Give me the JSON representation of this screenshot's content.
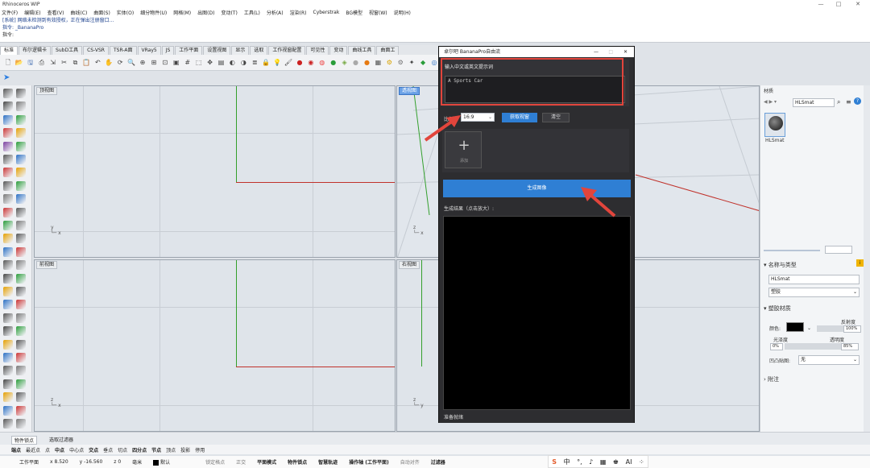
{
  "window": {
    "title": "Rhinoceros WIP"
  },
  "menu": [
    "文件(F)",
    "编辑(E)",
    "查看(V)",
    "曲线(C)",
    "曲面(S)",
    "实体(O)",
    "细分物件(U)",
    "网格(M)",
    "出图(D)",
    "变动(T)",
    "工具(L)",
    "分析(A)",
    "渲染(R)",
    "Cyberstrak",
    "BG模型",
    "视窗(W)",
    "说明(H)"
  ],
  "command_history": {
    "line1": "[系统] 网络未检测到有效授权，正在弹出注册窗口...",
    "line2": "指令: _BananaPro",
    "prompt": "指令:"
  },
  "tabs": [
    "标准",
    "布尔逻辑卡",
    "SubD工具",
    "CS-VSR",
    "TSR-A面",
    "VRay5",
    "JS",
    "工作平面",
    "设置视图",
    "显示",
    "选取",
    "工作视窗配置",
    "可见性",
    "变动",
    "曲线工具",
    "曲面工"
  ],
  "viewports": {
    "top": "顶视图",
    "perspective": "透视图",
    "front": "前视图",
    "right": "右视图",
    "axis_x": "x",
    "axis_y": "y",
    "axis_z": "z"
  },
  "plugin": {
    "title": "卓尔吧 BananaPro自由流",
    "prompt_label": "输入中文或英文提示词",
    "prompt_value": "A Sports Car",
    "ratio_label": "比例:",
    "ratio_value": "16:9",
    "get_view_button": "获取视窗",
    "clear_button": "清空",
    "add_label": "添加",
    "generate_button": "生成图像",
    "result_label": "生成结果（点击放大）:",
    "status": "准备就绪"
  },
  "right_panel": {
    "materials_title": "材质",
    "search_value": "HLSmat",
    "material_item": "HLSmat",
    "name_type_header": "名称与类型",
    "name_value": "HLSmat",
    "type_value": "塑胶",
    "plastic_header": "塑胶材质",
    "color_label": "颜色:",
    "reflect_label": "反射度",
    "reflect_value": "100%",
    "gloss_label": "光泽度",
    "gloss_value": "0%",
    "transparency_label": "透明度",
    "transparency_value": "85%",
    "bump_label": "凹凸贴图:",
    "bump_value": "无",
    "attachments_header": "附注",
    "color_hex": "#000000"
  },
  "status_tabs": [
    "物件锁点",
    "选取过滤器"
  ],
  "snaps": [
    "端点",
    "最近点",
    "点",
    "中点",
    "中心点",
    "交点",
    "垂点",
    "切点",
    "四分点",
    "节点",
    "顶点",
    "投影",
    "停用"
  ],
  "coords": {
    "cplane": "工作平面",
    "x": "x 8.520",
    "y": "y -16.560",
    "z": "z 0",
    "unit": "毫米",
    "layer": "默认",
    "lock_grid": "锁定格点",
    "ortho": "正交",
    "planar": "平面模式",
    "osnap": "物件锁点",
    "smart_track": "智慧轨迹",
    "gumball": "操作轴 (工作平面)",
    "autoalign": "自动对齐",
    "filter": "过滤器"
  },
  "colors": {
    "accent": "#2f7fd4",
    "annotation_red": "#e2453c"
  }
}
